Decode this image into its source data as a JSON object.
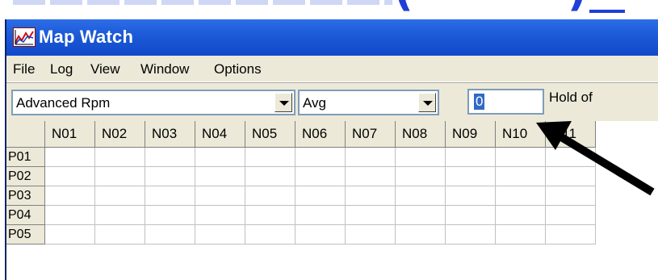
{
  "window": {
    "title": "Map Watch",
    "icon": "chart-icon"
  },
  "menu": {
    "items": [
      "File",
      "Log",
      "View",
      "Window",
      "Options"
    ]
  },
  "toolbar": {
    "parameter_select": "Advanced Rpm",
    "mode_select": "Avg",
    "hold_value": "0",
    "hold_label": "Hold of"
  },
  "grid": {
    "columns": [
      "N01",
      "N02",
      "N03",
      "N04",
      "N05",
      "N06",
      "N07",
      "N08",
      "N09",
      "N10",
      "N11"
    ],
    "rows": [
      "P01",
      "P02",
      "P03",
      "P04",
      "P05"
    ]
  },
  "colors": {
    "titlebar": "#1d5bd8",
    "selection": "#316ac5",
    "annotation_arrow": "#000000",
    "link_blue": "#1f3fd6"
  }
}
